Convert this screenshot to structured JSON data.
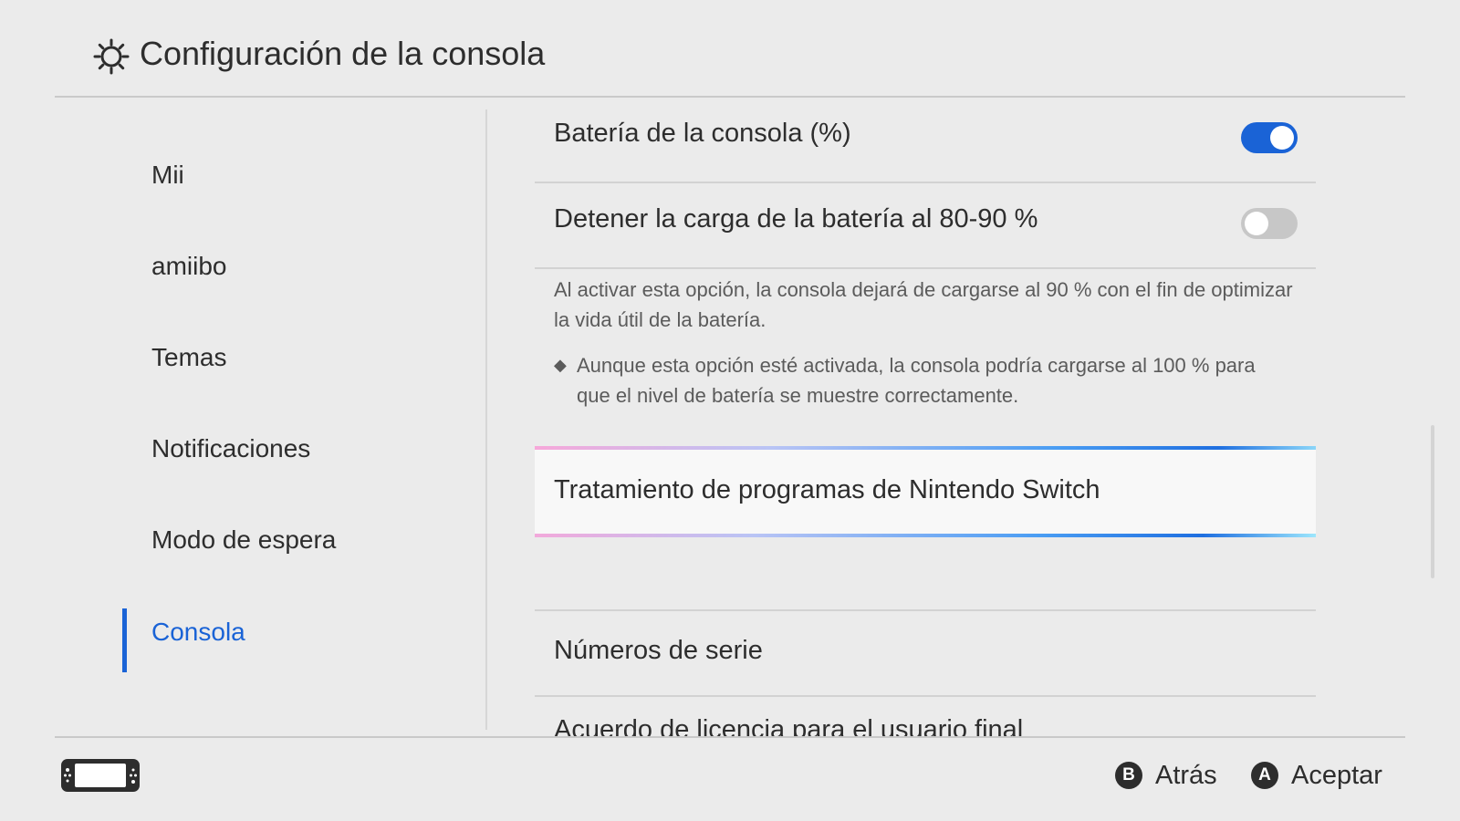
{
  "header": {
    "title": "Configuración de la consola",
    "icon": "gear-icon"
  },
  "sidebar": {
    "items": [
      {
        "label": "Mii",
        "active": false
      },
      {
        "label": "amiibo",
        "active": false
      },
      {
        "label": "Temas",
        "active": false
      },
      {
        "label": "Notificaciones",
        "active": false
      },
      {
        "label": "Modo de espera",
        "active": false
      },
      {
        "label": "Consola",
        "active": true
      }
    ]
  },
  "settings": {
    "battery_percent": {
      "label": "Batería de la consola (%)",
      "toggle": "on"
    },
    "stop_charging": {
      "label": "Detener la carga de la batería al 80-90 %",
      "toggle": "off"
    },
    "stop_charging_desc": "Al activar esta opción, la consola dejará de cargarse al 90 % con el fin de optimizar la vida útil de la batería.",
    "stop_charging_note": "Aunque esta opción esté activada, la consola podría cargarse al 100 % para que el nivel de batería se muestre correctamente.",
    "note_bullet": "◆",
    "software_handling": {
      "label": "Tratamiento de programas de Nintendo Switch",
      "focused": true
    },
    "serial_numbers": {
      "label": "Números de serie"
    },
    "eula": {
      "label": "Acuerdo de licencia para el usuario final"
    }
  },
  "footer": {
    "console_icon": "console-icon",
    "back": {
      "button": "B",
      "label": "Atrás"
    },
    "accept": {
      "button": "A",
      "label": "Aceptar"
    }
  },
  "colors": {
    "accent": "#1a63d6",
    "background": "#ebebeb",
    "text": "#2d2d2d",
    "toggle_off": "#c7c7c7"
  }
}
